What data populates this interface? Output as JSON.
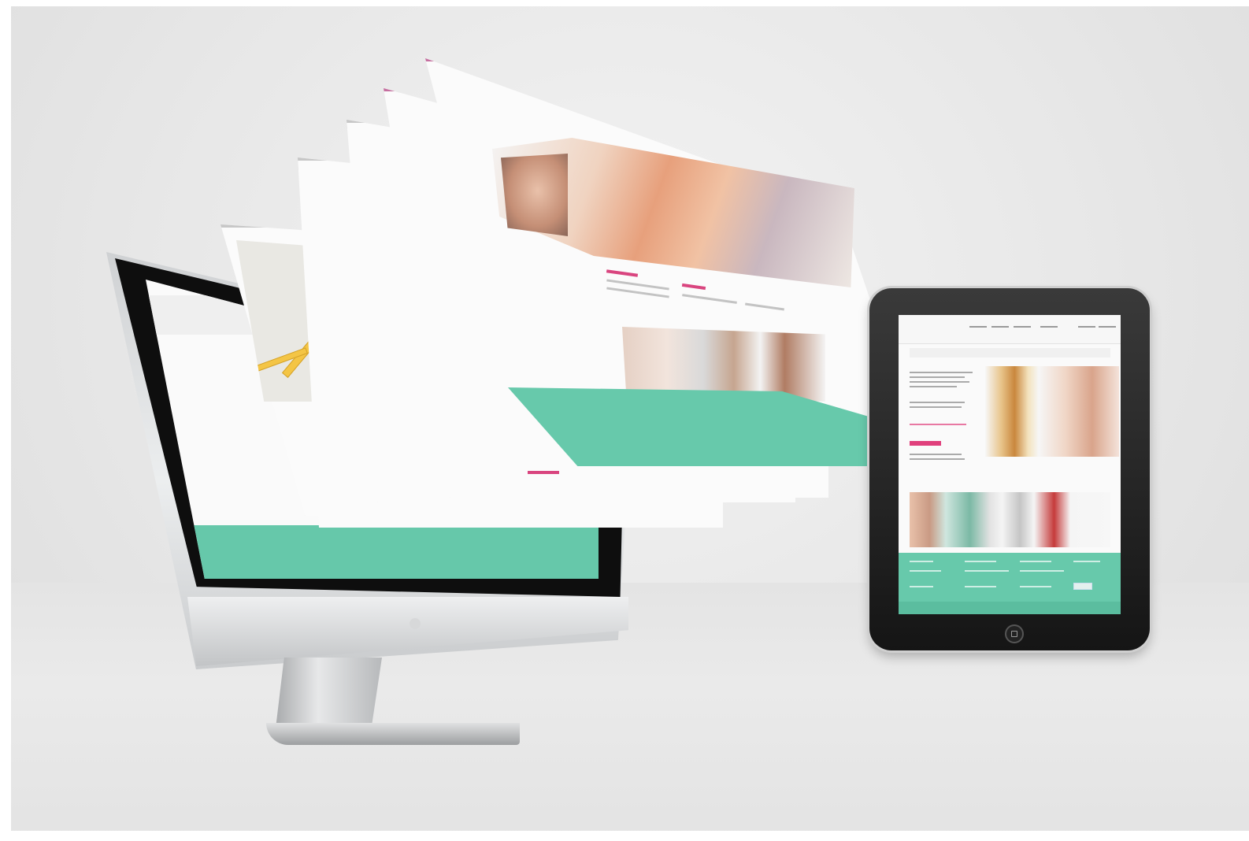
{
  "scene": {
    "description_colors": {
      "accent_mint": "#67c9ab",
      "accent_pink": "#d9457f",
      "device_dark": "#151515",
      "page_white": "#fbfbfb"
    }
  },
  "floating_pages": {
    "top_page": {
      "pink_heading": "",
      "logo": ""
    }
  },
  "tablet": {
    "site_logo": "",
    "page_title": ""
  }
}
